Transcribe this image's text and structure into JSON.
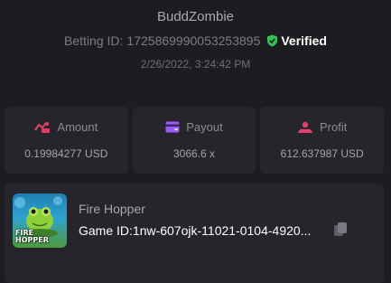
{
  "header": {
    "username": "BuddZombie",
    "betting_id_label": "Betting ID:",
    "betting_id": "1725869990053253895",
    "verified_label": "Verified",
    "timestamp": "2/26/2022, 3:24:42 PM"
  },
  "stats": [
    {
      "label": "Amount",
      "value": "0.19984277 USD",
      "icon": "amount-icon",
      "color": "#e0406a"
    },
    {
      "label": "Payout",
      "value": "3066.6 x",
      "icon": "wallet-icon",
      "color": "#9b5cf0"
    },
    {
      "label": "Profit",
      "value": "612.637987 USD",
      "icon": "profit-icon",
      "color": "#e0406a"
    }
  ],
  "game": {
    "name": "Fire Hopper",
    "id_label": "Game ID:",
    "id_value": "1nw-607ojk-11021-0104-4920...",
    "thumbnail_text": "FIRE HOPPER",
    "copy_icon": "copy-icon"
  },
  "colors": {
    "background": "#1c1c21",
    "card": "#25252b",
    "verified_shield": "#35c15a"
  }
}
